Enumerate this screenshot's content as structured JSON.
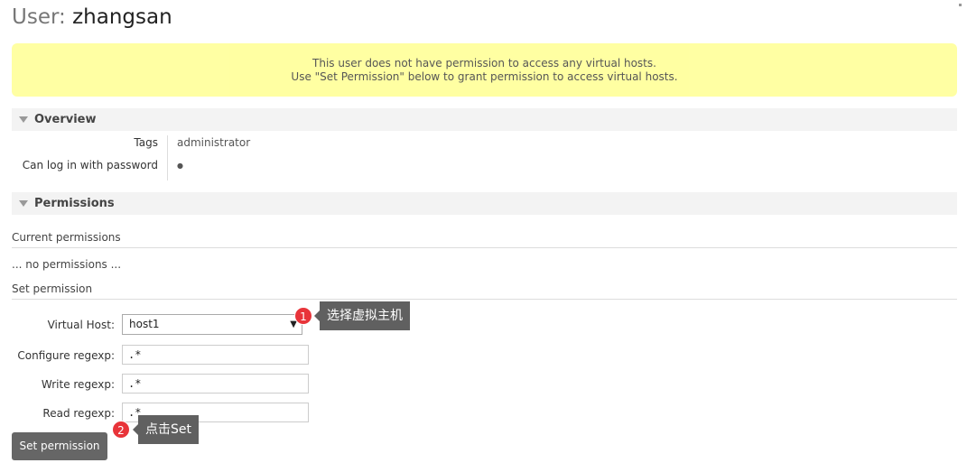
{
  "header": {
    "title_prefix": "User:",
    "title_name": "zhangsan"
  },
  "warning": {
    "line1": "This user does not have permission to access any virtual hosts.",
    "line2": "Use \"Set Permission\" below to grant permission to access virtual hosts."
  },
  "overview": {
    "title": "Overview",
    "rows": [
      {
        "label": "Tags",
        "value": "administrator"
      },
      {
        "label": "Can log in with password",
        "value": "●"
      }
    ]
  },
  "permissions": {
    "title": "Permissions",
    "current_heading": "Current permissions",
    "no_permissions": "... no permissions ...",
    "set_heading": "Set permission",
    "virtual_host_label": "Virtual Host:",
    "virtual_host_value": "host1",
    "configure_label": "Configure regexp:",
    "configure_value": ".*",
    "write_label": "Write regexp:",
    "write_value": ".*",
    "read_label": "Read regexp:",
    "read_value": ".*",
    "submit_label": "Set permission"
  },
  "annotations": [
    {
      "number": "1",
      "text": "选择虚拟主机"
    },
    {
      "number": "2",
      "text": "点击Set"
    }
  ],
  "colors": {
    "warning_bg": "#ffff99",
    "button_bg": "#666666",
    "badge": "#e8343a",
    "tooltip_bg": "#606060"
  }
}
